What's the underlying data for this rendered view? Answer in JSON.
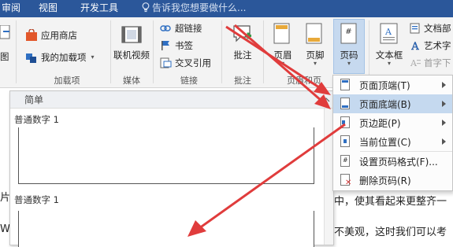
{
  "tabs": [
    {
      "label": "审阅",
      "key": "review"
    },
    {
      "label": "视图",
      "key": "view"
    },
    {
      "label": "开发工具",
      "key": "developer"
    }
  ],
  "tell_me": "告诉我您想要做什么...",
  "ribbon": {
    "far_left_label": "图",
    "addins": {
      "store": "应用商店",
      "my_addins": "我的加载项",
      "group_label": "加载项"
    },
    "media": {
      "online_video": "联机视频",
      "group_label": "媒体"
    },
    "links": {
      "hyperlink": "超链接",
      "bookmark": "书签",
      "cross_ref": "交叉引用",
      "group_label": "链接"
    },
    "comments": {
      "comment": "批注",
      "group_label": "批注"
    },
    "header_footer": {
      "header": "页眉",
      "footer": "页脚",
      "page_number": "页码",
      "group_label": "页眉和页"
    },
    "text": {
      "textbox": "文本框",
      "quick_parts": "文档部",
      "wordart": "艺术字",
      "dropcap": "首字下"
    }
  },
  "gallery": {
    "header": "简单",
    "items": [
      {
        "title": "普通数字 1"
      },
      {
        "title": "普通数字 1"
      }
    ]
  },
  "doc": {
    "left_line1": "片",
    "left_line2": "Wo",
    "right_line1": "中，使其看起来更整齐一",
    "right_line2": "不美观，这时我们可以考"
  },
  "menu": {
    "items": [
      {
        "label": "页面顶端(T)",
        "submenu": true,
        "active": false
      },
      {
        "label": "页面底端(B)",
        "submenu": true,
        "active": true
      },
      {
        "label": "页边距(P)",
        "submenu": true,
        "active": false
      },
      {
        "label": "当前位置(C)",
        "submenu": true,
        "active": false
      },
      {
        "label": "设置页码格式(F)...",
        "submenu": false,
        "active": false
      },
      {
        "label": "删除页码(R)",
        "submenu": false,
        "active": false
      }
    ]
  },
  "colors": {
    "tab_bar": "#2b579a",
    "ribbon_bg": "#f3f3f3",
    "highlight": "#c5d9ef",
    "arrow_red": "#e03c3c"
  }
}
